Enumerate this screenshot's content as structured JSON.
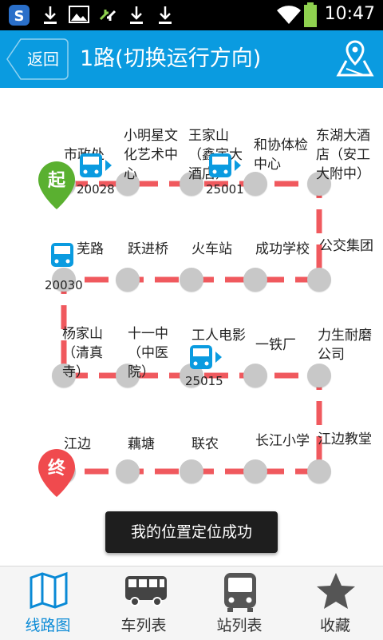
{
  "status_bar": {
    "time": "10:47",
    "icons": [
      "app-icon",
      "download-icon",
      "image-icon",
      "sync-icon",
      "download-icon",
      "download-icon",
      "wifi-icon",
      "battery-icon"
    ]
  },
  "header": {
    "back_label": "返回",
    "title": "1路(切换运行方向)",
    "map_icon": "map-location-icon",
    "color": "#0a9be0"
  },
  "route": {
    "line_color": "#f0595e",
    "start_badge": "起",
    "end_badge": "终",
    "stops_row1": [
      "市政处",
      "小明星文化艺术中心",
      "王家山（鑫宇大酒店）",
      "和协体检中心",
      "东湖大酒店（安工大附中）"
    ],
    "stops_row2": [
      "公交集团",
      "成功学校",
      "火车站",
      "跃进桥",
      "芜路"
    ],
    "stops_row3": [
      "杨家山（清真寺）",
      "十一中（中医院）",
      "工人电影",
      "一铁厂",
      "力生耐磨公司"
    ],
    "stops_row4": [
      "江边教堂",
      "长江小学",
      "联农",
      "藕塘",
      "江边"
    ],
    "buses": [
      "20028",
      "25001",
      "20030",
      "25015"
    ]
  },
  "toast": "我的位置定位成功",
  "tabs": [
    {
      "label": "线路图",
      "icon": "map-icon",
      "active": true
    },
    {
      "label": "车列表",
      "icon": "bus-icon",
      "active": false
    },
    {
      "label": "站列表",
      "icon": "bus-front-icon",
      "active": false
    },
    {
      "label": "收藏",
      "icon": "star-icon",
      "active": false
    }
  ]
}
